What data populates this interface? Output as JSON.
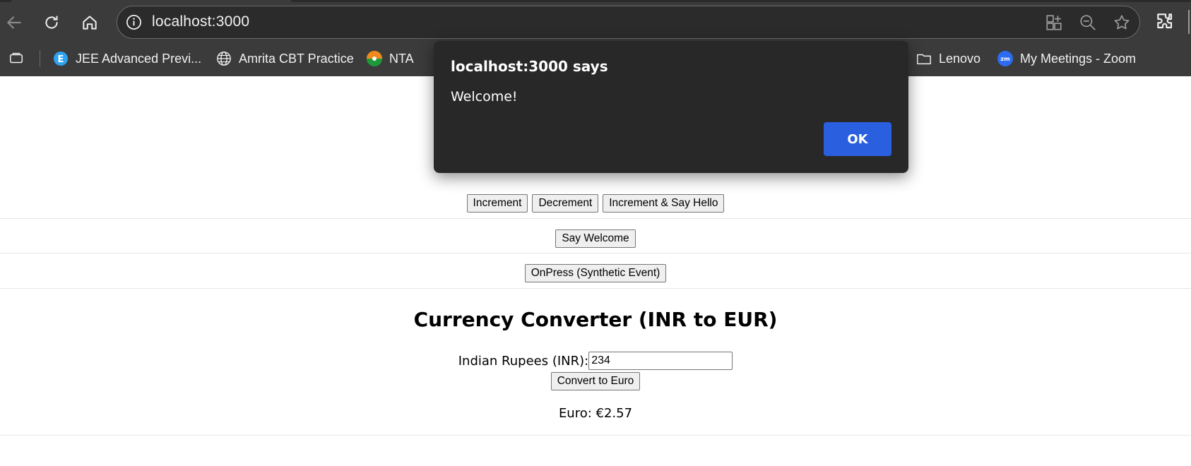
{
  "browser": {
    "address_bar": {
      "url": "localhost:3000"
    },
    "bookmarks": [
      {
        "label": "JEE Advanced Previ...",
        "icon": "jee-e-favicon-icon"
      },
      {
        "label": "Amrita CBT Practice",
        "icon": "globe-icon"
      },
      {
        "label": "NTA",
        "icon": "nta-favicon-icon"
      },
      {
        "label": "Lenovo",
        "icon": "folder-icon"
      },
      {
        "label": "My Meetings - Zoom",
        "icon": "zoom-favicon-icon"
      }
    ],
    "colors": {
      "chrome_bg": "#3b3b3b",
      "omnibox_bg": "#2b2b2b"
    }
  },
  "page": {
    "counter_buttons": {
      "increment": "Increment",
      "decrement": "Decrement",
      "increment_hello": "Increment & Say Hello"
    },
    "welcome_button": "Say Welcome",
    "onpress_button": "OnPress (Synthetic Event)",
    "currency": {
      "title": "Currency Converter (INR to EUR)",
      "inr_label": "Indian Rupees (INR):",
      "inr_value": "234",
      "convert_button": "Convert to Euro",
      "result": "Euro: €2.57"
    }
  },
  "dialog": {
    "title": "localhost:3000 says",
    "message": "Welcome!",
    "ok_label": "OK",
    "colors": {
      "bg": "#282828",
      "ok_bg": "#2a5fe0"
    }
  }
}
